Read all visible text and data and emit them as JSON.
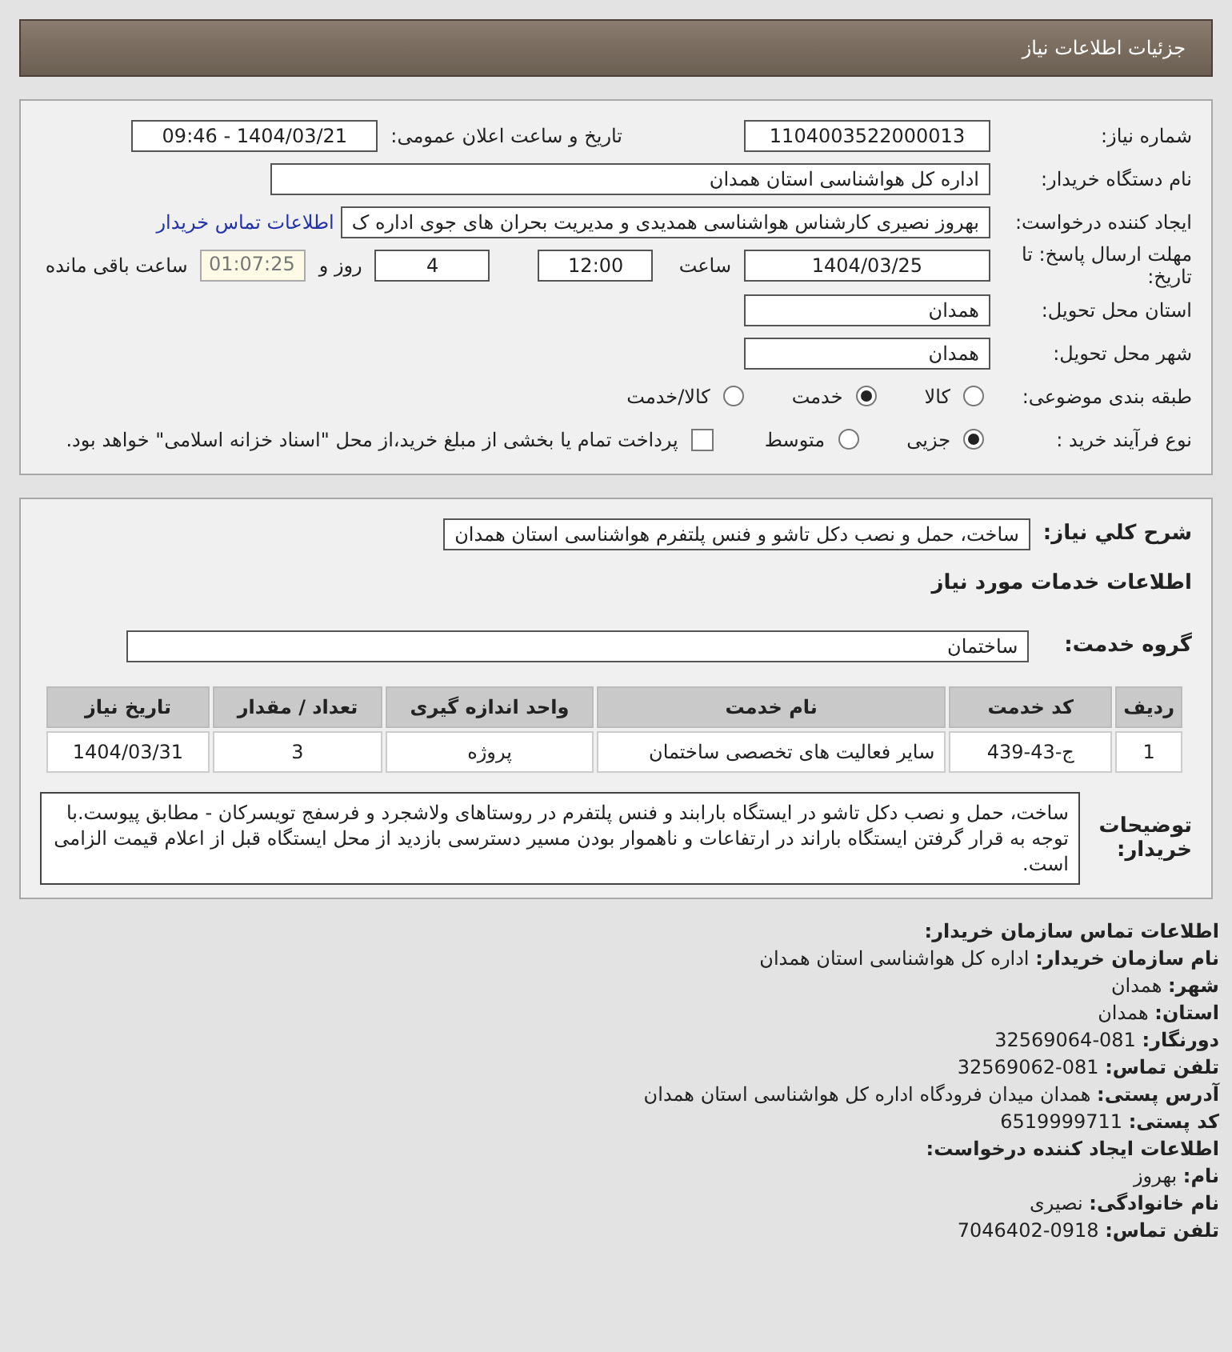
{
  "header": {
    "title": "جزئیات اطلاعات نیاز"
  },
  "need_info": {
    "need_number": {
      "label": "شماره نیاز:",
      "value": "1104003522000013"
    },
    "announce": {
      "label": "تاریخ و ساعت اعلان عمومی:",
      "value": "1404/03/21 - 09:46"
    },
    "buyer": {
      "label": "نام دستگاه خریدار:",
      "value": "اداره کل هواشناسی استان همدان"
    },
    "creator": {
      "label": "ایجاد کننده درخواست:",
      "value": "بهروز نصیری کارشناس هواشناسی همدیدی و مدیریت بحران های جوی  اداره ک",
      "link": "اطلاعات تماس خریدار"
    },
    "deadline": {
      "label": "مهلت ارسال پاسخ: تا تاریخ:",
      "date": "1404/03/25",
      "time_label": "ساعت",
      "time": "12:00",
      "days": "4",
      "days_label": "روز و",
      "remaining": "01:07:25",
      "remaining_label": "ساعت باقی مانده"
    },
    "province": {
      "label": "استان محل تحویل:",
      "value": "همدان"
    },
    "city": {
      "label": "شهر محل تحویل:",
      "value": "همدان"
    },
    "category": {
      "label": "طبقه بندی موضوعی:",
      "options": [
        {
          "label": "کالا",
          "selected": false
        },
        {
          "label": "خدمت",
          "selected": true
        },
        {
          "label": "کالا/خدمت",
          "selected": false
        }
      ]
    },
    "process": {
      "label": "نوع فرآیند خرید :",
      "options": [
        {
          "label": "جزیی",
          "selected": true
        },
        {
          "label": "متوسط",
          "selected": false
        }
      ],
      "payment": {
        "checked": false,
        "text": "پرداخت تمام یا بخشی از مبلغ خرید،از محل \"اسناد خزانه اسلامی\" خواهد بود."
      }
    }
  },
  "details": {
    "summary": {
      "label": "شرح کلي نياز:",
      "value": "ساخت، حمل و نصب دکل تاشو و فنس پلتفرم هواشناسی استان همدان"
    },
    "section_title": "اطلاعات خدمات مورد نیاز",
    "service_group": {
      "label": "گروه خدمت:",
      "value": "ساختمان"
    },
    "table": {
      "columns": [
        "ردیف",
        "کد خدمت",
        "نام خدمت",
        "واحد اندازه گیری",
        "تعداد / مقدار",
        "تاریخ نیاز"
      ],
      "rows": [
        [
          "1",
          "ج-43-439",
          "سایر فعالیت های تخصصی ساختمان",
          "پروژه",
          "3",
          "1404/03/31"
        ]
      ]
    },
    "notes": {
      "label": "توضیحات خریدار:",
      "value": "ساخت، حمل و نصب دکل تاشو در ایستگاه بارابند و فنس پلتفرم در روستاهای ولاشجرد و فرسفج تویسرکان - مطابق پیوست.با توجه به قرار گرفتن ایستگاه باراند در ارتفاعات و ناهموار بودن مسیر دسترسی بازدید از محل ایستگاه قبل از اعلام قیمت الزامی است."
    }
  },
  "contact": [
    {
      "kind": "heading",
      "text": "اطلاعات تماس سازمان خریدار:"
    },
    {
      "kind": "line",
      "text": "**نام سازمان خریدار:** اداره کل هواشناسی استان همدان"
    },
    {
      "kind": "line",
      "text": "**شهر:** همدان"
    },
    {
      "kind": "line",
      "text": "**استان:** همدان"
    },
    {
      "kind": "line",
      "text": "**دورنگار:** 081-32569064"
    },
    {
      "kind": "line",
      "text": "**تلفن تماس:** 081-32569062"
    },
    {
      "kind": "line",
      "text": "**آدرس پستی:** همدان میدان فرودگاه اداره کل هواشناسی استان همدان"
    },
    {
      "kind": "line",
      "text": "**کد پستی:** 6519999711"
    },
    {
      "kind": "heading",
      "text": "اطلاعات ایجاد کننده درخواست:"
    },
    {
      "kind": "line",
      "text": "**نام:** بهروز"
    },
    {
      "kind": "line",
      "text": "**نام خانوادگی:** نصیری"
    },
    {
      "kind": "line",
      "text": "**تلفن تماس:** 0918-7046402"
    }
  ]
}
